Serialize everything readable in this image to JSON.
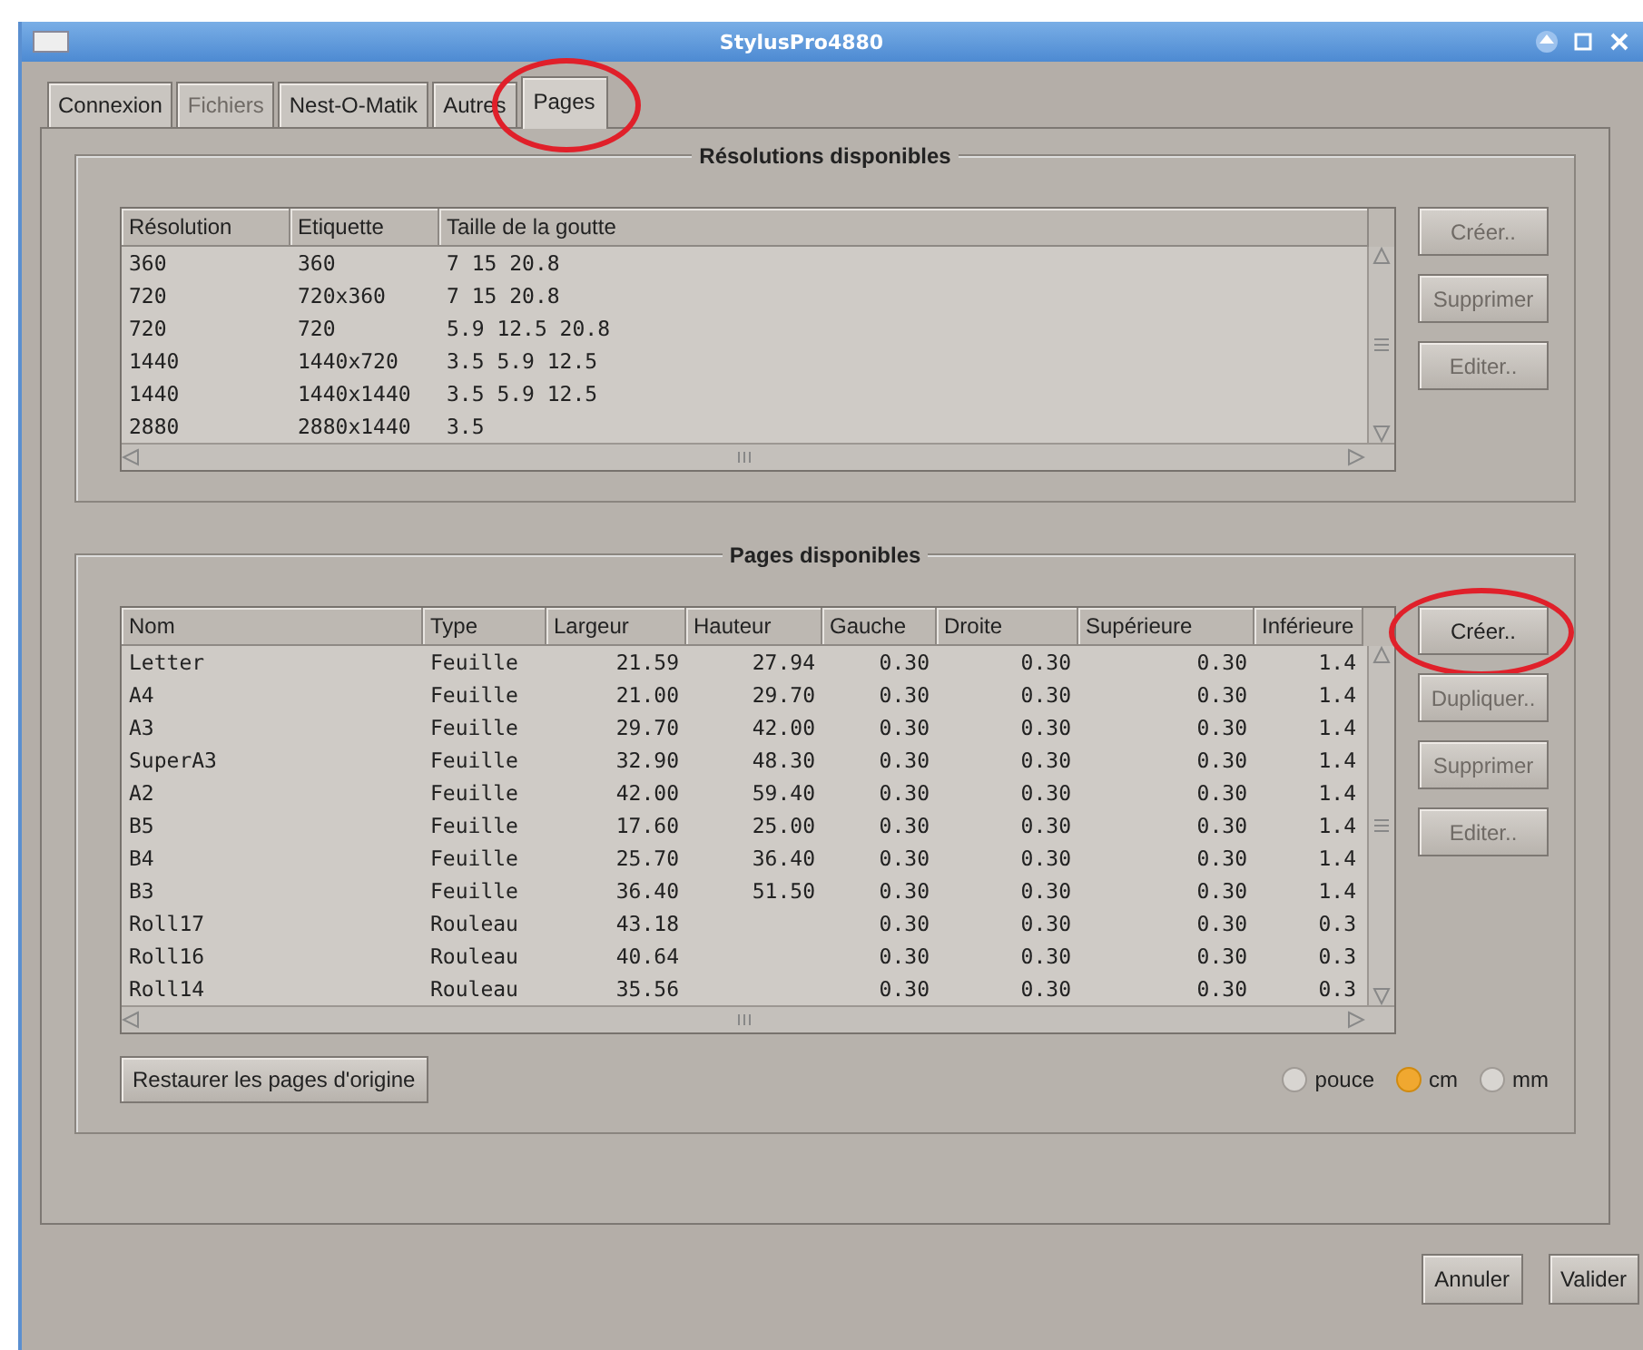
{
  "window": {
    "title": "StylusPro4880"
  },
  "tabs": [
    {
      "label": "Connexion",
      "selected": false,
      "disabled": false,
      "circled": false
    },
    {
      "label": "Fichiers",
      "selected": false,
      "disabled": true,
      "circled": false
    },
    {
      "label": "Nest-O-Matik",
      "selected": false,
      "disabled": false,
      "circled": false
    },
    {
      "label": "Autres",
      "selected": false,
      "disabled": false,
      "circled": false
    },
    {
      "label": "Pages",
      "selected": true,
      "disabled": false,
      "circled": true
    }
  ],
  "resolutions": {
    "title": "Résolutions disponibles",
    "columns": [
      "Résolution",
      "Etiquette",
      "Taille de la goutte"
    ],
    "rows": [
      [
        "360",
        "360",
        "7 15 20.8"
      ],
      [
        "720",
        "720x360",
        "7 15 20.8"
      ],
      [
        "720",
        "720",
        "5.9 12.5 20.8"
      ],
      [
        "1440",
        "1440x720",
        "3.5 5.9 12.5"
      ],
      [
        "1440",
        "1440x1440",
        "3.5 5.9 12.5"
      ],
      [
        "2880",
        "2880x1440",
        "3.5"
      ]
    ],
    "buttons": [
      {
        "label": "Créer..",
        "disabled": true,
        "circled": false
      },
      {
        "label": "Supprimer",
        "disabled": true,
        "circled": false
      },
      {
        "label": "Editer..",
        "disabled": true,
        "circled": false
      }
    ]
  },
  "pages": {
    "title": "Pages disponibles",
    "columns": [
      "Nom",
      "Type",
      "Largeur",
      "Hauteur",
      "Gauche",
      "Droite",
      "Supérieure",
      "Inférieure"
    ],
    "rows": [
      [
        "Letter",
        "Feuille",
        "21.59",
        "27.94",
        "0.30",
        "0.30",
        "0.30",
        "1.4"
      ],
      [
        "A4",
        "Feuille",
        "21.00",
        "29.70",
        "0.30",
        "0.30",
        "0.30",
        "1.4"
      ],
      [
        "A3",
        "Feuille",
        "29.70",
        "42.00",
        "0.30",
        "0.30",
        "0.30",
        "1.4"
      ],
      [
        "SuperA3",
        "Feuille",
        "32.90",
        "48.30",
        "0.30",
        "0.30",
        "0.30",
        "1.4"
      ],
      [
        "A2",
        "Feuille",
        "42.00",
        "59.40",
        "0.30",
        "0.30",
        "0.30",
        "1.4"
      ],
      [
        "B5",
        "Feuille",
        "17.60",
        "25.00",
        "0.30",
        "0.30",
        "0.30",
        "1.4"
      ],
      [
        "B4",
        "Feuille",
        "25.70",
        "36.40",
        "0.30",
        "0.30",
        "0.30",
        "1.4"
      ],
      [
        "B3",
        "Feuille",
        "36.40",
        "51.50",
        "0.30",
        "0.30",
        "0.30",
        "1.4"
      ],
      [
        "Roll17",
        "Rouleau",
        "43.18",
        "",
        "0.30",
        "0.30",
        "0.30",
        "0.3"
      ],
      [
        "Roll16",
        "Rouleau",
        "40.64",
        "",
        "0.30",
        "0.30",
        "0.30",
        "0.3"
      ],
      [
        "Roll14",
        "Rouleau",
        "35.56",
        "",
        "0.30",
        "0.30",
        "0.30",
        "0.3"
      ]
    ],
    "buttons": [
      {
        "label": "Créer..",
        "disabled": false,
        "circled": true
      },
      {
        "label": "Dupliquer..",
        "disabled": true,
        "circled": false
      },
      {
        "label": "Supprimer",
        "disabled": true,
        "circled": false
      },
      {
        "label": "Editer..",
        "disabled": true,
        "circled": false
      }
    ],
    "restore_button": "Restaurer les pages d'origine",
    "units": [
      {
        "label": "pouce",
        "selected": false
      },
      {
        "label": "cm",
        "selected": true
      },
      {
        "label": "mm",
        "selected": false
      }
    ]
  },
  "footer_buttons": [
    "Annuler",
    "Valider"
  ]
}
